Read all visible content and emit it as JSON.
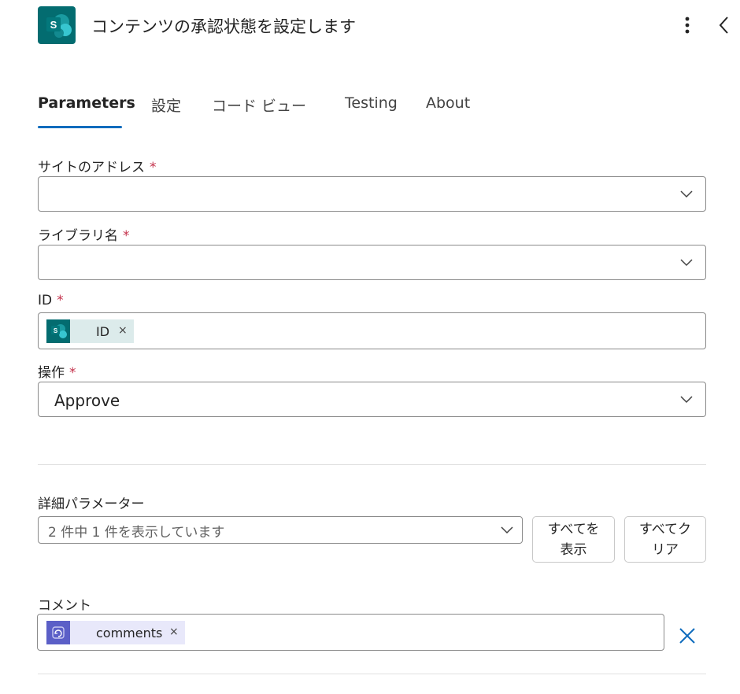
{
  "header": {
    "title": "コンテンツの承認状態を設定します",
    "app_icon": "sharepoint-icon",
    "more_icon": "more-vertical-icon",
    "back_icon": "chevron-left-icon"
  },
  "tabs": [
    {
      "label": "Parameters",
      "active": true
    },
    {
      "label": "設定",
      "active": false
    },
    {
      "label": "コード ビュー",
      "active": false
    },
    {
      "label": "Testing",
      "active": false
    },
    {
      "label": "About",
      "active": false
    }
  ],
  "fields": {
    "site": {
      "label": "サイトのアドレス",
      "required_mark": "*",
      "value": ""
    },
    "library": {
      "label": "ライブラリ名",
      "required_mark": "*",
      "value": ""
    },
    "id": {
      "label": "ID",
      "required_mark": "*",
      "token": {
        "label": "ID",
        "icon": "sharepoint-icon",
        "remove": "×"
      }
    },
    "action": {
      "label": "操作",
      "required_mark": "*",
      "value": "Approve"
    }
  },
  "advanced": {
    "label": "詳細パラメーター",
    "summary": "2 件中 1 件を表示しています",
    "show_all": "すべてを\n表示",
    "clear_all": "すべてク\nリア"
  },
  "comment": {
    "label": "コメント",
    "token": {
      "label": "comments",
      "icon": "approvals-icon",
      "remove": "×"
    },
    "clear_icon": "close-icon"
  },
  "colors": {
    "accent": "#0f6cbd",
    "sharepoint": "#036c70",
    "approvals": "#5b5fc7",
    "required": "#c4314b"
  }
}
